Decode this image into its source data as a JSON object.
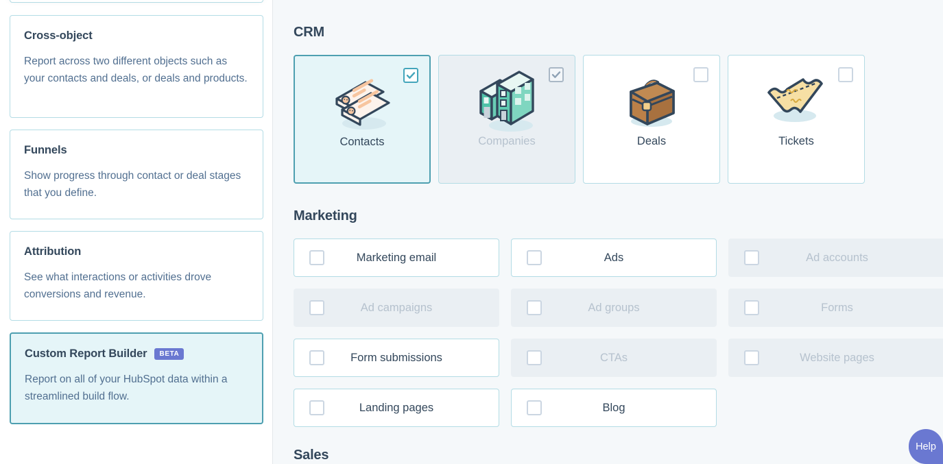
{
  "sidebar": {
    "cards": [
      {
        "title": "Cross-object",
        "desc": "Report across two different objects such as your contacts and deals, or deals and products.",
        "selected": false,
        "badge": ""
      },
      {
        "title": "Funnels",
        "desc": "Show progress through contact or deal stages that you define.",
        "selected": false,
        "badge": ""
      },
      {
        "title": "Attribution",
        "desc": "See what interactions or activities drove conversions and revenue.",
        "selected": false,
        "badge": ""
      },
      {
        "title": "Custom Report Builder",
        "desc": "Report on all of your HubSpot data within a streamlined build flow.",
        "selected": true,
        "badge": "BETA"
      }
    ]
  },
  "main": {
    "sections": [
      {
        "title": "CRM",
        "layout": "cards",
        "items": [
          {
            "label": "Contacts",
            "icon": "contacts-icon",
            "checked": true,
            "disabled": false
          },
          {
            "label": "Companies",
            "icon": "companies-icon",
            "checked": true,
            "disabled": true
          },
          {
            "label": "Deals",
            "icon": "deals-icon",
            "checked": false,
            "disabled": false
          },
          {
            "label": "Tickets",
            "icon": "tickets-icon",
            "checked": false,
            "disabled": false
          }
        ]
      },
      {
        "title": "Marketing",
        "layout": "rows",
        "items": [
          {
            "label": "Marketing email",
            "checked": false,
            "disabled": false
          },
          {
            "label": "Ads",
            "checked": false,
            "disabled": false
          },
          {
            "label": "Ad accounts",
            "checked": false,
            "disabled": true
          },
          {
            "label": "Ad campaigns",
            "checked": false,
            "disabled": true
          },
          {
            "label": "Ad groups",
            "checked": false,
            "disabled": true
          },
          {
            "label": "Forms",
            "checked": false,
            "disabled": true
          },
          {
            "label": "Form submissions",
            "checked": false,
            "disabled": false
          },
          {
            "label": "CTAs",
            "checked": false,
            "disabled": true
          },
          {
            "label": "Website pages",
            "checked": false,
            "disabled": true
          },
          {
            "label": "Landing pages",
            "checked": false,
            "disabled": false
          },
          {
            "label": "Blog",
            "checked": false,
            "disabled": false
          }
        ]
      },
      {
        "title": "Sales",
        "layout": "rows",
        "items": []
      }
    ]
  },
  "help": {
    "label": "Help"
  },
  "colors": {
    "accent_teal": "#4d9fb0",
    "checkbox_teal": "#43a5bb",
    "selected_bg": "#e5f5f8",
    "disabled_bg": "#eaeff3",
    "border_light": "#b3dce5",
    "text_dark": "#33475b",
    "text_muted": "#516f90",
    "text_disabled": "#b6c2ce",
    "badge_purple": "#6a78d1",
    "panel_bg": "#f5f8fa"
  }
}
